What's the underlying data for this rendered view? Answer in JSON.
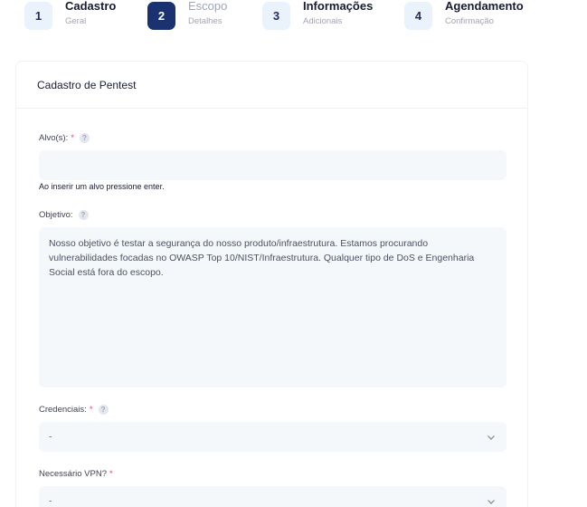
{
  "stepper": {
    "steps": [
      {
        "number": "1",
        "title": "Cadastro",
        "subtitle": "Geral"
      },
      {
        "number": "2",
        "title": "Escopo",
        "subtitle": "Detalhes"
      },
      {
        "number": "3",
        "title": "Informações",
        "subtitle": "Adicionais"
      },
      {
        "number": "4",
        "title": "Agendamento",
        "subtitle": "Confirmação"
      }
    ],
    "active_step": 2
  },
  "card": {
    "title": "Cadastro de Pentest"
  },
  "form": {
    "alvos": {
      "label": "Alvo(s):",
      "required_mark": "*",
      "help_mark": "?",
      "value": "",
      "hint": "Ao inserir um alvo pressione enter."
    },
    "objetivo": {
      "label": "Objetivo:",
      "help_mark": "?",
      "value": "Nosso objetivo é testar a segurança do nosso produto/infraestrutura. Estamos procurando vulnerabilidades focadas no OWASP Top 10/NIST/Infraestrutura. Qualquer tipo de DoS e Engenharia Social está fora do escopo."
    },
    "credenciais": {
      "label": "Credenciais:",
      "required_mark": "*",
      "help_mark": "?",
      "selected": "-"
    },
    "vpn": {
      "label": "Necessário VPN?",
      "required_mark": "*",
      "selected": "-"
    }
  },
  "colors": {
    "active_step_bg": "#1a3370",
    "step_bg": "#eaf2fc",
    "required": "#f1416c",
    "field_bg": "#f5f8fa"
  },
  "icons": {
    "help": "question-circle-icon",
    "select_arrow": "chevron-down-icon"
  }
}
